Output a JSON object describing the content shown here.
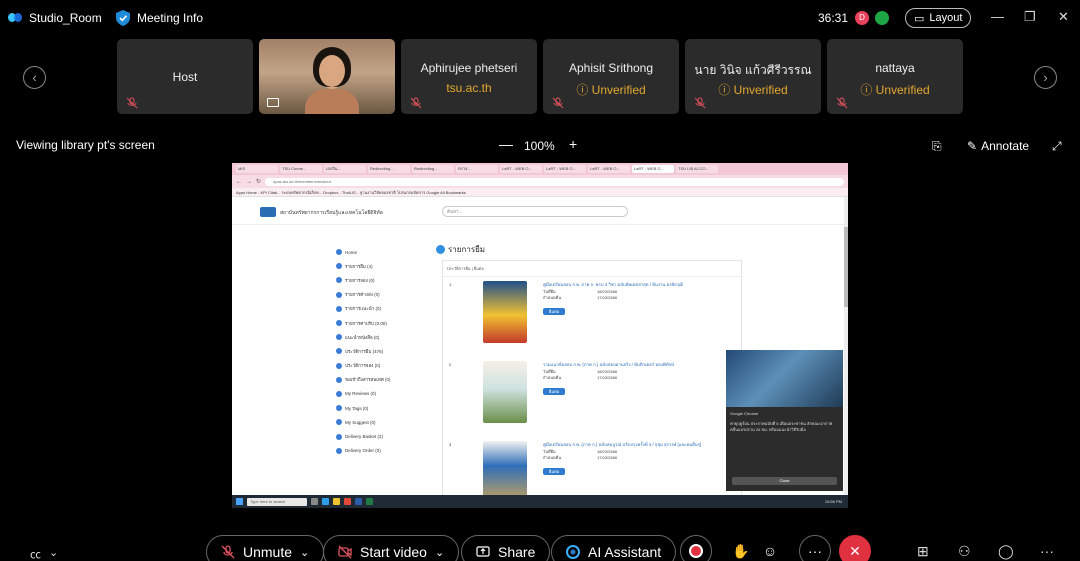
{
  "app": {
    "name": "Studio_Room",
    "meeting_info": "Meeting Info",
    "timer": "36:31",
    "rec_label": "D",
    "layout_label": "Layout"
  },
  "window_controls": {
    "minimize": "—",
    "restore": "❐",
    "close": "✕"
  },
  "participants": [
    {
      "name": "Host",
      "sub": ""
    },
    {
      "name": "",
      "sub": ""
    },
    {
      "name": "Aphirujee phetseri",
      "sub": "tsu.ac.th"
    },
    {
      "name": "Aphisit Srithong",
      "sub": "Unverified"
    },
    {
      "name": "นาย วินิจ แก้วศีรีวรรณ",
      "sub": "Unverified"
    },
    {
      "name": "nattaya",
      "sub": "Unverified"
    }
  ],
  "share": {
    "viewing_label": "Viewing library pt's screen",
    "zoom_minus": "—",
    "zoom": "100%",
    "zoom_plus": "+",
    "annotate_label": "Annotate"
  },
  "browser": {
    "tabs": [
      "MIS",
      "TSU Conne...",
      "เอกสิน...",
      "Redirecting...",
      "Redirecting...",
      "ตรวจ...",
      "LaRT - WEB O...",
      "LaRT - WEB O...",
      "LaRT - WEB O...",
      "LaRT - WEB O...",
      "TSU LIB ACCO..."
    ],
    "url": "opac.tsu.ac.th/member/checkout",
    "bookmarks": "Apps  Home - KPI Citati...  ระบบทรัพยากรอิเล็กท...  Dropbox - ThaiLIS...  ฐานงานวิจัยของชาติ  โปรแกรมจัดการ  Google  All Bookmarks"
  },
  "site": {
    "title": "สถาบันทรัพยากรการเรียนรู้และเทคโนโลยีดิจิทัล",
    "search_placeholder": "ค้นหา...",
    "page_heading": "รายการยืม",
    "list_header": "ประวัติการยืม  |  ยืมต่อ",
    "menu": [
      "Home",
      "รายการยืม (4)",
      "รายการจอง (0)",
      "รายการค้างส่ง (0)",
      "รายการแนะนำ (0)",
      "รายการค่าปรับ (0.00)",
      "แนะนำหนังสือ (0)",
      "ประวัติการยืม (476)",
      "ประวัติการจอง (0)",
      "ขอเข้าถึงสารสนเทศ (0)",
      "My Reviews (0)",
      "My Tags (0)",
      "My Suggest (0)",
      "Delivery Basket (2)",
      "Delivery Order (0)"
    ],
    "books": [
      {
        "num": "1",
        "title": "คู่มือเตรียมสอบ ก.พ. ภาค ก. ครบ 4 วิชา ฉบับอัพเดตล่าสุด / ทีมงาน ธงชัยวุฒิ",
        "borrow_label": "วันที่ยืม",
        "borrow_date": "18/03/2568",
        "due_label": "กำหนดคืน",
        "due_date": "17/03/2568",
        "renew": "ยืมต่อ"
      },
      {
        "num": "2",
        "title": "รวมแนวข้อสอบ ก.พ. (ภาค ก.) ฉบับสอบผ่านจริง / ทีมติวเตอร์ ทองพิทักษ์",
        "borrow_label": "วันที่ยืม",
        "borrow_date": "18/03/2568",
        "due_label": "กำหนดคืน",
        "due_date": "17/03/2568",
        "renew": "ยืมต่อ"
      },
      {
        "num": "3",
        "title": "คู่มือเตรียมสอบ ก.พ. (ภาค ก.) ฉบับสมบูรณ์ ปรับปรุงครั้งที่ 4 / กุสุม สุรวงษ์ [และคนอื่นๆ]",
        "borrow_label": "วันที่ยืม",
        "borrow_date": "18/03/2568",
        "due_label": "กำหนดคืน",
        "due_date": "17/03/2568",
        "renew": "ยืมต่อ"
      }
    ],
    "notification": {
      "source": "Google Chrome",
      "text": "พายุฤดูร้อน ประกาศฉบับที่ 5 เตือนประชาชน ลักษณะอากาศคลื่นแปรปรวน 26 ชม. พร้อมแนะนำวิธีรับมือ",
      "close": "Close"
    },
    "taskbar_search": "Type here to search",
    "taskbar_time": "15:56 PM"
  },
  "controls": {
    "unmute": "Unmute",
    "start_video": "Start video",
    "share": "Share",
    "ai_assistant": "AI Assistant",
    "more": "···"
  },
  "colors": {
    "accent_red": "#e03140",
    "unverified": "#e4a830",
    "bg": "#000000"
  }
}
